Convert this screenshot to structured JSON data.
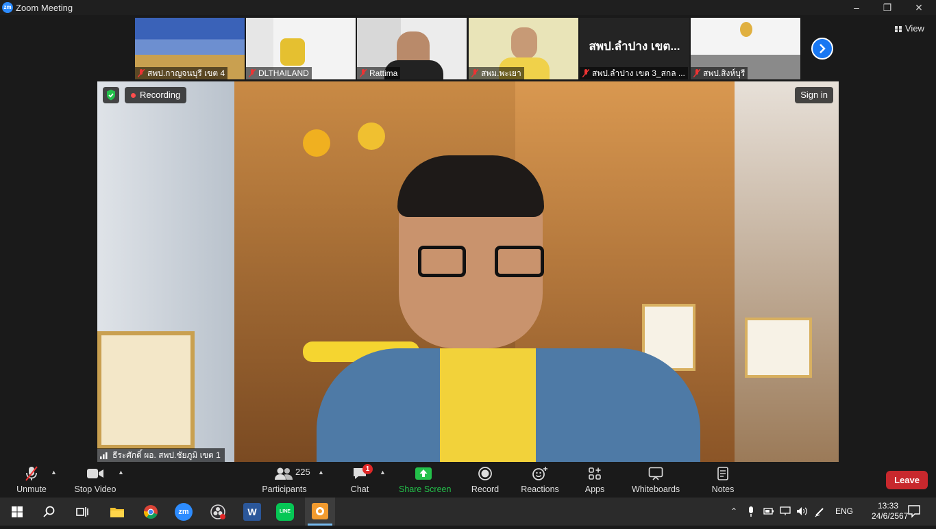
{
  "window": {
    "app_logo": "zm",
    "title": "Zoom Meeting"
  },
  "thumbnails": [
    {
      "name": "สพป.กาญจนบุรี เขต 4",
      "big": ""
    },
    {
      "name": "DLTHAILAND",
      "big": ""
    },
    {
      "name": "Rattima",
      "big": ""
    },
    {
      "name": "สพม.พะเยา",
      "big": ""
    },
    {
      "name": "สพป.ลำปาง  เขต 3_สกล ...",
      "big": "สพป.ลำปาง เขต..."
    },
    {
      "name": "สพป.สิงห์บุรี",
      "big": ""
    }
  ],
  "view_label": "View",
  "main": {
    "recording_label": "Recording",
    "sign_in_label": "Sign in",
    "speaker_name": "ธีระศักดิ์ ผอ. สพป.ชัยภูมิ เขต 1"
  },
  "toolbar": {
    "unmute": "Unmute",
    "stop_video": "Stop Video",
    "participants": "Participants",
    "participant_count": "225",
    "chat": "Chat",
    "chat_badge": "1",
    "share_screen": "Share Screen",
    "record": "Record",
    "reactions": "Reactions",
    "apps": "Apps",
    "whiteboards": "Whiteboards",
    "notes": "Notes",
    "leave": "Leave"
  },
  "taskbar": {
    "zoom_icon": "zm",
    "word_icon": "W",
    "line_icon": "LINE",
    "lang": "ENG",
    "time": "13:33",
    "date": "24/6/2567"
  },
  "colors": {
    "accent": "#1877f2",
    "share_green": "#23c04a",
    "leave_red": "#c8282d",
    "recording_red": "#ff4d4d"
  }
}
